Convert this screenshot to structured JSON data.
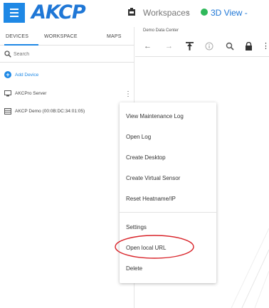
{
  "header": {
    "logo_text": "AKCP",
    "breadcrumb": {
      "workspaces": "Workspaces",
      "separator": "›",
      "current": "3D View -"
    }
  },
  "left_panel": {
    "tabs": [
      "DEVICES",
      "WORKSPACE",
      "MAPS"
    ],
    "active_tab": "DEVICES",
    "search_placeholder": "Search",
    "add_device_label": "Add Device",
    "devices": [
      {
        "label": "AKCPro Server",
        "icon": "monitor-icon"
      },
      {
        "label": "AKCP Demo (00:0B:DC:34:01:05)",
        "icon": "device-icon"
      }
    ]
  },
  "right_panel": {
    "title": "Demo Data Center",
    "toolbar_icons": [
      "back-arrow-icon",
      "forward-arrow-icon",
      "pin-icon",
      "info-icon",
      "search-icon",
      "lock-icon"
    ]
  },
  "context_menu": {
    "group1": [
      "View Maintenance Log",
      "Open Log",
      "Create Desktop",
      "Create Virtual Sensor",
      "Reset Heatname/IP"
    ],
    "group2": [
      "Settings",
      "Open local URL",
      "Delete"
    ],
    "highlighted_item": "Open local URL"
  },
  "colors": {
    "accent": "#1e88e5",
    "logo": "#1f77d6",
    "status_dot": "#2fb85a",
    "highlight_ring": "#d9252b"
  }
}
